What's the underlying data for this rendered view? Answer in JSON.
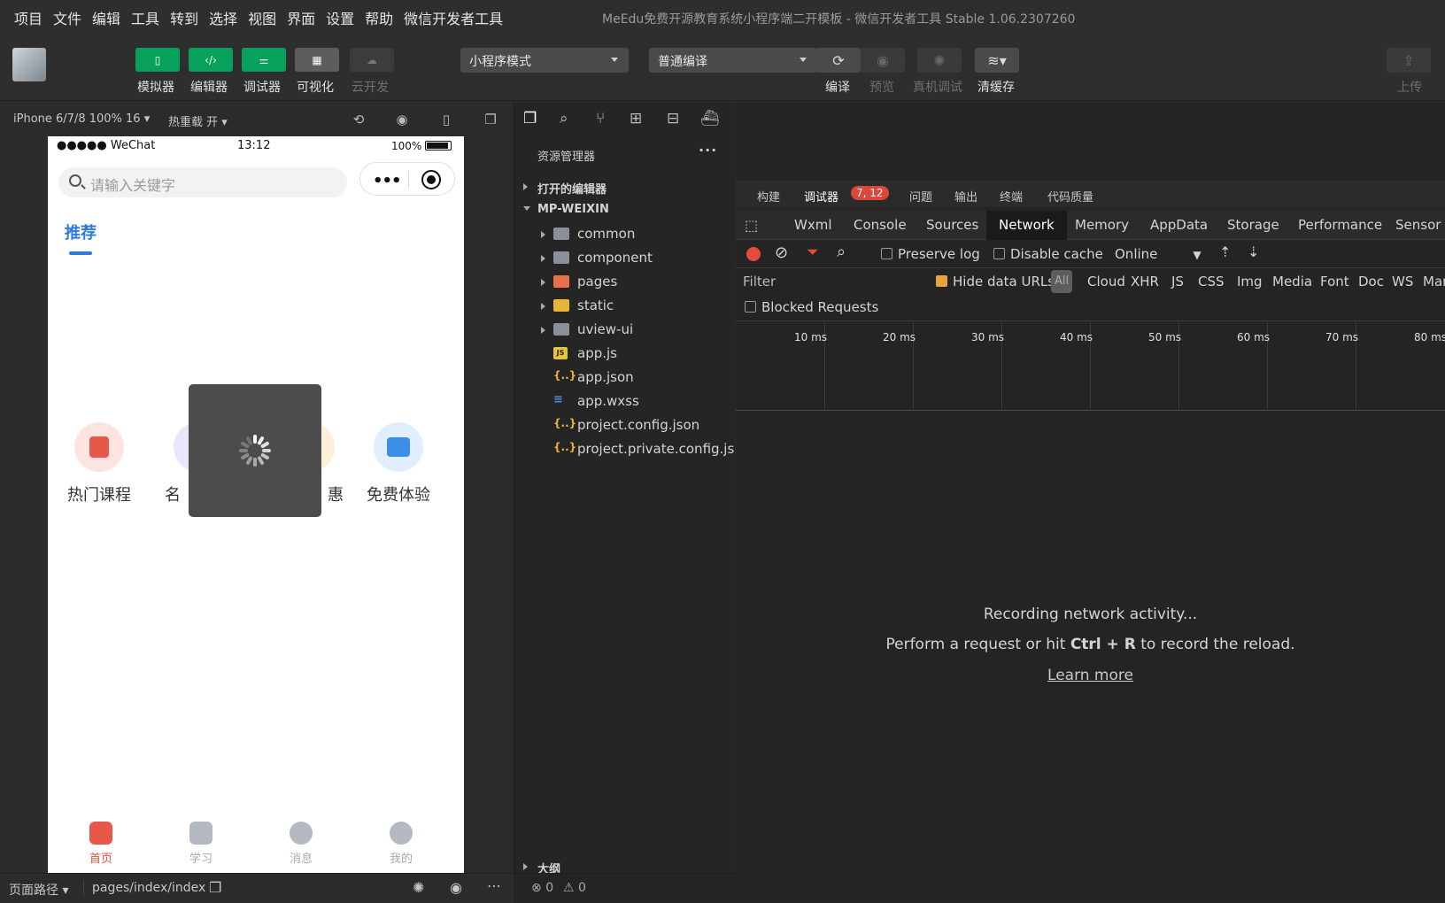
{
  "menu": [
    "项目",
    "文件",
    "编辑",
    "工具",
    "转到",
    "选择",
    "视图",
    "界面",
    "设置",
    "帮助",
    "微信开发者工具"
  ],
  "window_title": "MeEdu免费开源教育系统小程序端二开模板 - 微信开发者工具 Stable 1.06.2307260",
  "toolbar": {
    "simulator": "模拟器",
    "editor": "编辑器",
    "debugger": "调试器",
    "visual": "可视化",
    "cloud": "云开发",
    "mode": "小程序模式",
    "compile_mode": "普通编译",
    "compile": "编译",
    "preview": "预览",
    "remote_debug": "真机调试",
    "clear_cache": "清缓存",
    "upload": "上传"
  },
  "sim": {
    "device": "iPhone 6/7/8 100% 16",
    "hotreload": "热重载 开",
    "status_carrier": "●●●●● WeChat",
    "status_time": "13:12",
    "status_battery": "100%",
    "search_placeholder": "请输入关键字",
    "tab": "推荐",
    "categories": [
      "热门课程",
      "名",
      "惠",
      "免费体验"
    ],
    "tabbar": [
      "首页",
      "学习",
      "消息",
      "我的"
    ],
    "page_path_label": "页面路径",
    "page_path": "pages/index/index"
  },
  "explorer": {
    "title": "资源管理器",
    "open_editors": "打开的编辑器",
    "project": "MP-WEIXIN",
    "items": [
      {
        "name": "common",
        "type": "folder"
      },
      {
        "name": "component",
        "type": "folder"
      },
      {
        "name": "pages",
        "type": "folder-pages"
      },
      {
        "name": "static",
        "type": "folder-static"
      },
      {
        "name": "uview-ui",
        "type": "folder"
      },
      {
        "name": "app.js",
        "type": "js"
      },
      {
        "name": "app.json",
        "type": "json"
      },
      {
        "name": "app.wxss",
        "type": "css"
      },
      {
        "name": "project.config.json",
        "type": "json"
      },
      {
        "name": "project.private.config.js...",
        "type": "json"
      }
    ],
    "outline": "大纲"
  },
  "debugger": {
    "top_tabs": [
      "构建",
      "调试器",
      "问题",
      "输出",
      "终端",
      "代码质量"
    ],
    "badge": "7, 12",
    "devtools_tabs": [
      "Wxml",
      "Console",
      "Sources",
      "Network",
      "Memory",
      "AppData",
      "Storage",
      "Performance",
      "Sensor"
    ],
    "active_tab": "Network",
    "preserve_log": "Preserve log",
    "disable_cache": "Disable cache",
    "throttle": "Online",
    "filter_placeholder": "Filter",
    "hide_data_urls": "Hide data URLs",
    "all": "All",
    "types": [
      "Cloud",
      "XHR",
      "JS",
      "CSS",
      "Img",
      "Media",
      "Font",
      "Doc",
      "WS",
      "Manife"
    ],
    "blocked": "Blocked Requests",
    "ticks": [
      "10 ms",
      "20 ms",
      "30 ms",
      "40 ms",
      "50 ms",
      "60 ms",
      "70 ms",
      "80 ms"
    ],
    "msg_recording": "Recording network activity...",
    "msg_perform_pre": "Perform a request or hit ",
    "msg_keys": "Ctrl + R",
    "msg_perform_post": " to record the reload.",
    "learn_more": "Learn more",
    "errors": "0",
    "warnings": "0"
  },
  "colors": {
    "green": "#07a15c",
    "accent_blue": "#2f7bd8",
    "badge_red": "#d9493b",
    "checkbox_orange": "#e8a23a"
  }
}
